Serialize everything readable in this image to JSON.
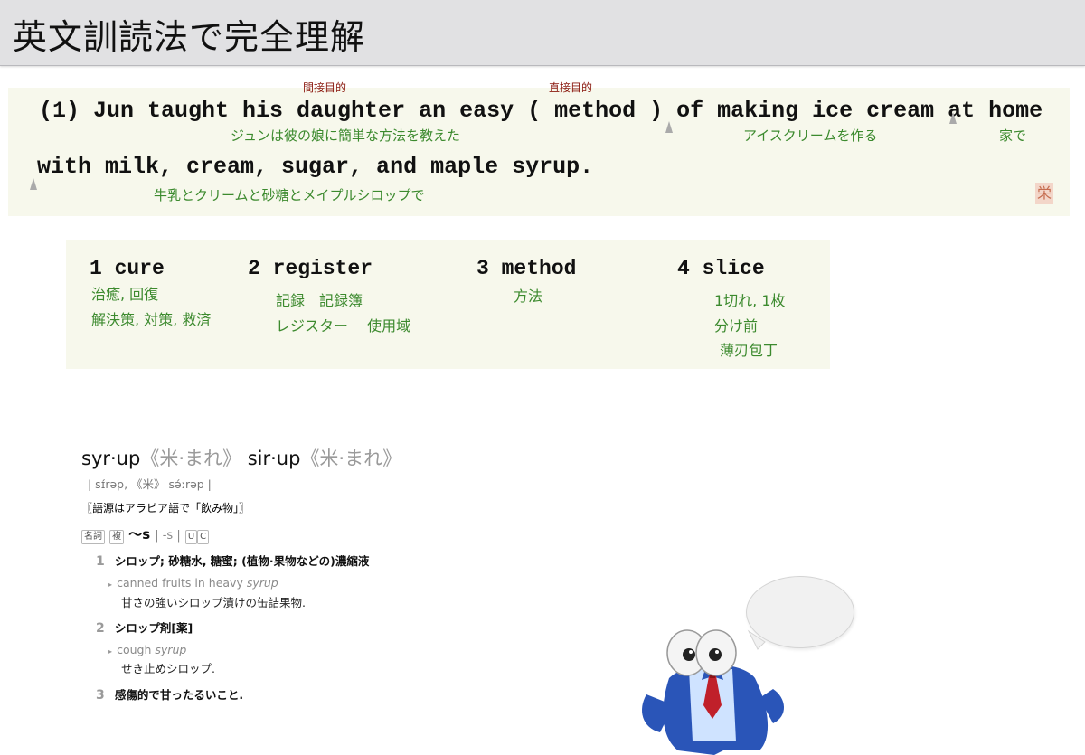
{
  "title": "英文訓読法で完全理解",
  "sentence": {
    "line1": "(1) Jun taught his daughter an easy ( method ) of making ice cream at home",
    "line2": "with milk, cream, sugar, and maple syrup.",
    "tags": {
      "indirect_object": "間接目的",
      "direct_object": "直接目的"
    },
    "glosses": {
      "main": "ジュンは彼の娘に簡単な方法を教えた",
      "ice_cream": "アイスクリームを作る",
      "home": "家で",
      "with": "牛乳とクリームと砂糖とメイプルシロップで"
    },
    "stamp": "栄"
  },
  "choices": [
    {
      "word": "1 cure",
      "meanings": [
        "治癒, 回復",
        "解決策, 対策, 救済"
      ]
    },
    {
      "word": "2 register",
      "meanings": [
        "記録　記録簿",
        "レジスター　 使用域"
      ]
    },
    {
      "word": "3 method",
      "meanings": [
        "方法"
      ]
    },
    {
      "word": "4 slice",
      "meanings": [
        "1切れ, 1枚",
        "分け前",
        "薄刃包丁"
      ]
    }
  ],
  "dictionary": {
    "headword1": "syr·up",
    "label1": "《米·まれ》",
    "headword2": "sir·up",
    "label2": "《米·まれ》",
    "pronunciation": "| sɪ́rəp, 《米》 sə́ːrəp |",
    "etymology": "〖語源はアラビア語で「飲み物」〗",
    "pos": "名詞",
    "plural_badge": "複",
    "inflection": "〜s",
    "forms": "| -s |",
    "badge_u": "U",
    "badge_c": "C",
    "senses": [
      {
        "num": "1",
        "text": "シロップ; 砂糖水, 糖蜜; (植物·果物などの)濃縮液",
        "example_pre": "canned fruits in heavy ",
        "example_em": "syrup",
        "translation": "甘さの強いシロップ漬けの缶詰果物."
      },
      {
        "num": "2",
        "text": "シロップ剤[薬]",
        "example_pre": "cough ",
        "example_em": "syrup",
        "translation": "せき止めシロップ."
      },
      {
        "num": "3",
        "text": "感傷的で甘ったるいこと."
      }
    ]
  },
  "colors": {
    "header_bg": "#e1e1e3",
    "panel_bg": "#f7f8ec",
    "gloss_green": "#3c8a2e",
    "tag_red": "#8b1a10",
    "mascot_blue": "#2a55b8",
    "tie_red": "#c0202a"
  },
  "icons": {
    "mascot": "penguin-mascot-icon",
    "bubble": "speech-bubble-icon",
    "stamp": "seal-stamp-icon"
  }
}
